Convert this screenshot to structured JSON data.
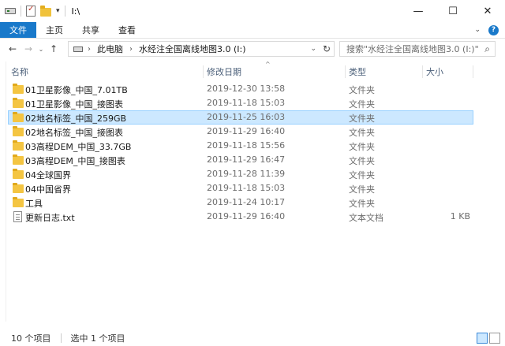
{
  "window": {
    "title": "I:\\",
    "minimize": "—",
    "maximize": "☐",
    "close": "✕"
  },
  "quick_access": {
    "dropdown": "▾"
  },
  "ribbon": {
    "file_tab": "文件",
    "tabs": [
      "主页",
      "共享",
      "查看"
    ],
    "expand": "⌄",
    "help": "?"
  },
  "nav": {
    "back": "←",
    "forward": "→",
    "recent": "⌄",
    "up": "↑",
    "crumb_sep": "›",
    "breadcrumb": [
      "此电脑",
      "水经注全国离线地图3.0 (I:)"
    ],
    "address_dropdown": "⌄",
    "refresh": "↻",
    "search_placeholder": "搜索\"水经注全国离线地图3.0 (I:)\"",
    "search_icon": "⌕"
  },
  "columns": {
    "name": "名称",
    "date": "修改日期",
    "type": "类型",
    "size": "大小",
    "sort_indicator": "^"
  },
  "files": [
    {
      "name": "01卫星影像_中国_7.01TB",
      "date": "2019-12-30 13:58",
      "type": "文件夹",
      "size": "",
      "icon": "folder-icon"
    },
    {
      "name": "01卫星影像_中国_接图表",
      "date": "2019-11-18 15:03",
      "type": "文件夹",
      "size": "",
      "icon": "folder-icon"
    },
    {
      "name": "02地名标签_中国_259GB",
      "date": "2019-11-25 16:03",
      "type": "文件夹",
      "size": "",
      "icon": "folder-icon",
      "selected": true
    },
    {
      "name": "02地名标签_中国_接图表",
      "date": "2019-11-29 16:40",
      "type": "文件夹",
      "size": "",
      "icon": "folder-icon"
    },
    {
      "name": "03高程DEM_中国_33.7GB",
      "date": "2019-11-18 15:56",
      "type": "文件夹",
      "size": "",
      "icon": "folder-icon"
    },
    {
      "name": "03高程DEM_中国_接图表",
      "date": "2019-11-29 16:47",
      "type": "文件夹",
      "size": "",
      "icon": "folder-icon"
    },
    {
      "name": "04全球国界",
      "date": "2019-11-28 11:39",
      "type": "文件夹",
      "size": "",
      "icon": "folder-icon"
    },
    {
      "name": "04中国省界",
      "date": "2019-11-18 15:03",
      "type": "文件夹",
      "size": "",
      "icon": "folder-icon"
    },
    {
      "name": "工具",
      "date": "2019-11-24 10:17",
      "type": "文件夹",
      "size": "",
      "icon": "folder-icon"
    },
    {
      "name": "更新日志.txt",
      "date": "2019-11-29 16:40",
      "type": "文本文档",
      "size": "1 KB",
      "icon": "text-file-icon"
    }
  ],
  "status": {
    "item_count": "10 个项目",
    "selected_count": "选中 1 个项目"
  }
}
